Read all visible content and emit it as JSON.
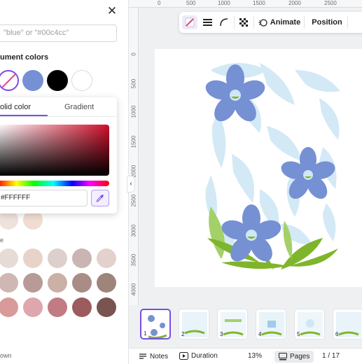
{
  "color_panel": {
    "search_placeholder": "\"blue\" or \"#00c4cc\"",
    "document_colors_label": "ument colors",
    "document_colors": [
      "none",
      "#7690d4",
      "#000000",
      "#ffffff"
    ],
    "picker": {
      "tab_solid": "olid color",
      "tab_gradient": "Gradient",
      "hex_value": "#FFFFFF",
      "saturation_hue": "#d00f2b"
    },
    "label_e": "e",
    "label_own": "own",
    "palette": [
      [
        "#efe2dc",
        "#f0dcd0"
      ],
      [
        "#e7dbd6",
        "#e8d3c8",
        "#ddcfcb",
        "#c9b5b2",
        "#e4d0cc"
      ],
      [
        "#cfb8b3",
        "#b89b96",
        "#cbb0a6",
        "#a98c86",
        "#9f847c"
      ],
      [
        "#d99a9a",
        "#e0a6ad",
        "#c27b82",
        "#9c5c5e",
        "#7a5450"
      ]
    ]
  },
  "ruler": {
    "top_ticks": [
      "0",
      "500",
      "1000",
      "1500",
      "2000",
      "2500"
    ],
    "left_ticks": [
      "0",
      "500",
      "1000",
      "1500",
      "2000",
      "2500",
      "3000",
      "3500",
      "4000"
    ]
  },
  "toolbar": {
    "animate_label": "Animate",
    "position_label": "Position"
  },
  "thumbnails": [
    "1",
    "2",
    "3",
    "4",
    "5",
    "6"
  ],
  "statusbar": {
    "notes_label": "Notes",
    "duration_label": "Duration",
    "zoom": "13%",
    "pages_label": "Pages",
    "page_count": "1 / 17"
  },
  "colors": {
    "accent": "#7b4ee6",
    "flower_blue": "#7690d4",
    "leaf_green": "#7fb52b",
    "leaf_light_blue": "#cfe7f6"
  }
}
